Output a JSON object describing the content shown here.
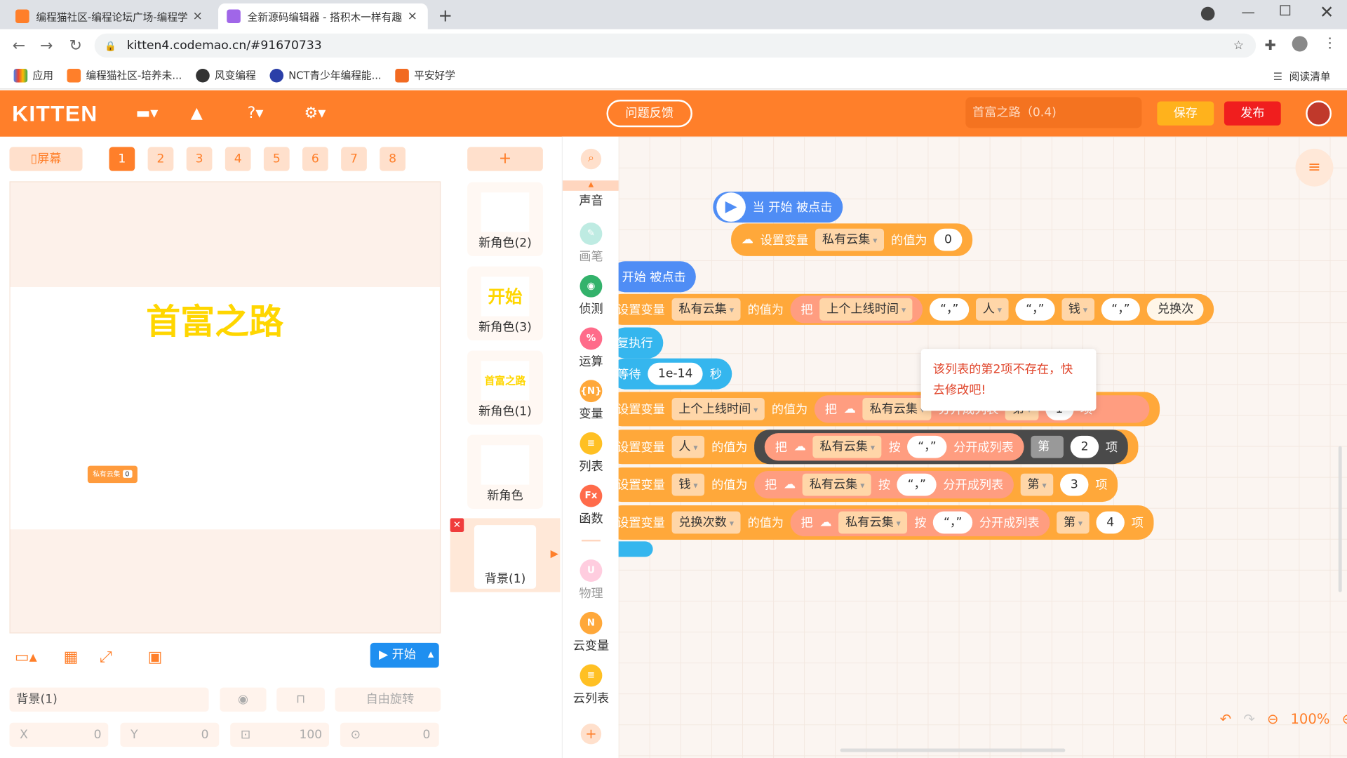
{
  "browser": {
    "tabs": [
      {
        "title": "编程猫社区-编程论坛广场-编程学",
        "close": "×"
      },
      {
        "title": "全新源码编辑器 - 搭积木一样有趣",
        "close": "×"
      }
    ],
    "new_tab": "+",
    "url": "kitten4.codemao.cn/#91670733",
    "bookmarks": [
      "应用",
      "编程猫社区-培养未...",
      "风变编程",
      "NCT青少年编程能...",
      "平安好学"
    ],
    "reading_list": "阅读清单"
  },
  "header": {
    "logo": "KITTEN",
    "feedback": "问题反馈",
    "project_name": "首富之路（0.4)",
    "save": "保存",
    "publish": "发布"
  },
  "stage": {
    "screen_btn": "屏幕",
    "screens": [
      "1",
      "2",
      "3",
      "4",
      "5",
      "6",
      "7",
      "8"
    ],
    "selected_screen": "1",
    "title_text": "首富之路",
    "cloud_monitor": "私有云集",
    "cloud_value": "0",
    "start": "开始",
    "sprite_name": "背景(1)",
    "rotate": "自由旋转",
    "x_label": "X",
    "x_value": "0",
    "y_label": "Y",
    "y_value": "0",
    "size_value": "100",
    "dir_value": "0"
  },
  "sprites": {
    "add": "+",
    "items": [
      {
        "name": "新角色(2)",
        "thumb": ""
      },
      {
        "name": "新角色(3)",
        "thumb": "开始"
      },
      {
        "name": "新角色(1)",
        "thumb": "首富之路"
      },
      {
        "name": "新角色",
        "thumb": ""
      }
    ],
    "background": "背景(1)"
  },
  "categories": [
    {
      "label": "声音",
      "color": "#ff7f2a",
      "icon": "♪"
    },
    {
      "label": "画笔",
      "color": "#7fd9c6",
      "icon": "✎"
    },
    {
      "label": "侦测",
      "color": "#33b26b",
      "icon": "◉"
    },
    {
      "label": "运算",
      "color": "#ff6b8a",
      "icon": "%"
    },
    {
      "label": "变量",
      "color": "#ffa83a",
      "icon": "{N}"
    },
    {
      "label": "列表",
      "color": "#ffc023",
      "icon": "≡"
    },
    {
      "label": "函数",
      "color": "#ff6b4a",
      "icon": "Fx"
    },
    {
      "label": "物理",
      "color": "#ff9cc0",
      "icon": "U"
    },
    {
      "label": "云变量",
      "color": "#ffa83a",
      "icon": "N"
    },
    {
      "label": "云列表",
      "color": "#ffc023",
      "icon": "≡"
    }
  ],
  "blocks": {
    "when_start_1": "当 开始 被点击",
    "set_var": "设置变量",
    "cloud_var": "私有云集",
    "value_is": "的值为",
    "zero": "0",
    "when_start_2": "开始 被点击",
    "ba": "把",
    "last_online": "上个上线时间",
    "comma": "“，”",
    "ren": "人",
    "qian": "钱",
    "exchange": "兑换次",
    "repeat": "复执行",
    "wait": "等待",
    "wait_val": "1e-14",
    "sec": "秒",
    "by": "按",
    "split": "分开成列表",
    "di": "第",
    "item": "项",
    "i1": "1",
    "i2": "2",
    "i3": "3",
    "i4": "4",
    "exchange_count": "兑换次数",
    "tooltip": "该列表的第2项不存在，快去修改吧!"
  },
  "zoom": "100%"
}
